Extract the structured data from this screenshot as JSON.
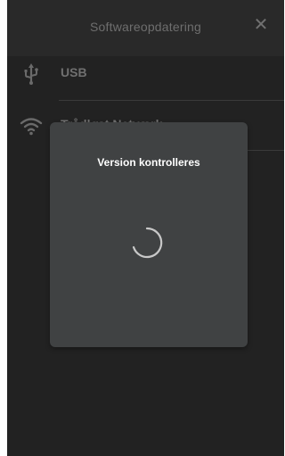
{
  "header": {
    "title": "Softwareopdatering",
    "close_glyph": "✕"
  },
  "menu": [
    {
      "label": "USB",
      "icon": "usb-icon"
    },
    {
      "label": "Trådløst Netværk",
      "icon": "wifi-icon"
    }
  ],
  "dialog": {
    "title": "Version kontrolleres",
    "icon": "loading-spinner-icon"
  },
  "colors": {
    "background": "#222222",
    "dialog": "#404243",
    "spinner": "#c8c8c8"
  }
}
